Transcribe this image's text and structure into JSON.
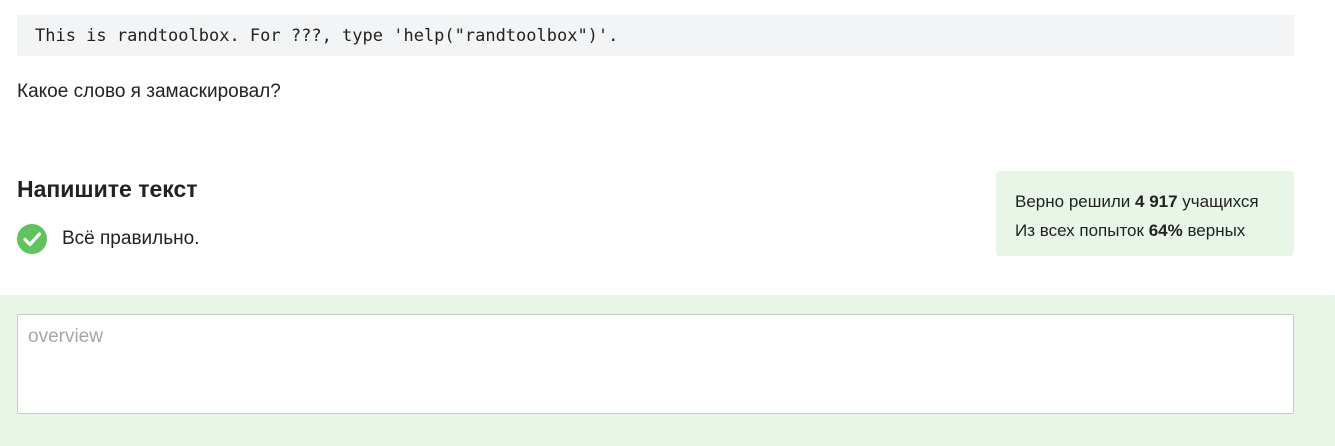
{
  "code": {
    "text": "This is randtoolbox. For ???, type 'help(\"randtoolbox\")'."
  },
  "question": {
    "text": "Какое слово я замаскировал?"
  },
  "task": {
    "title": "Напишите текст",
    "result_text": "Всё правильно.",
    "result_icon": "check-circle-icon"
  },
  "stats": {
    "line1_prefix": "Верно решили",
    "solved_count": "4 917",
    "line1_suffix": "учащихся",
    "line2_prefix": "Из всех попыток",
    "correct_percent": "64%",
    "line2_suffix": "верных"
  },
  "answer": {
    "placeholder": "overview"
  },
  "colors": {
    "success_green": "#5ec45b",
    "stats_background": "#e7f6e6",
    "code_background": "#f3f4f5"
  }
}
